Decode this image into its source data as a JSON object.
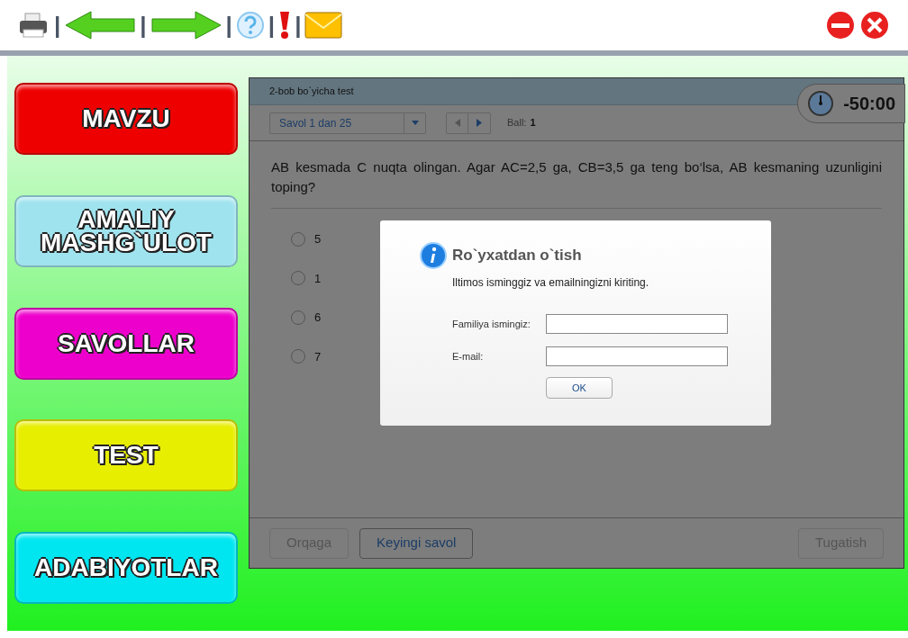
{
  "toolbar": {
    "separator": "|"
  },
  "sidebar": {
    "items": [
      {
        "label": "MAVZU",
        "color": "#ee0000"
      },
      {
        "label": "AMALIY MASHG`ULOT",
        "color": "#9fe3ee"
      },
      {
        "label": "SAVOLLAR",
        "color": "#ee00cc"
      },
      {
        "label": "TEST",
        "color": "#e8ee00"
      },
      {
        "label": "ADABIYOTLAR",
        "color": "#00e6f0"
      }
    ]
  },
  "quiz": {
    "title": "2-bob bo`yicha test",
    "timer": "-50:00",
    "question_select": "Savol 1 dan 25",
    "score_label": "Ball:",
    "score": "1",
    "question": "AB kesmada C nuqta olingan. Agar AC=2,5 ga, CB=3,5 ga teng bo‘lsa, AB kesmaning uzunligini toping?",
    "options": [
      {
        "label": "5",
        "selected": false
      },
      {
        "label": "1",
        "selected": false
      },
      {
        "label": "6",
        "selected": false
      },
      {
        "label": "7",
        "selected": false
      }
    ],
    "buttons": [
      {
        "label": "Orqaga",
        "disabled": true
      },
      {
        "label": "Keyingi savol",
        "disabled": false
      },
      {
        "label": "Tugatish",
        "disabled": true
      }
    ]
  },
  "dialog": {
    "title": "Ro`yxatdan o`tish",
    "message": "Iltimos isminggiz va emailningizni kiriting.",
    "fields": [
      {
        "label": "Familiya ismingiz:"
      },
      {
        "label": "E-mail:"
      }
    ],
    "ok": "OK"
  }
}
